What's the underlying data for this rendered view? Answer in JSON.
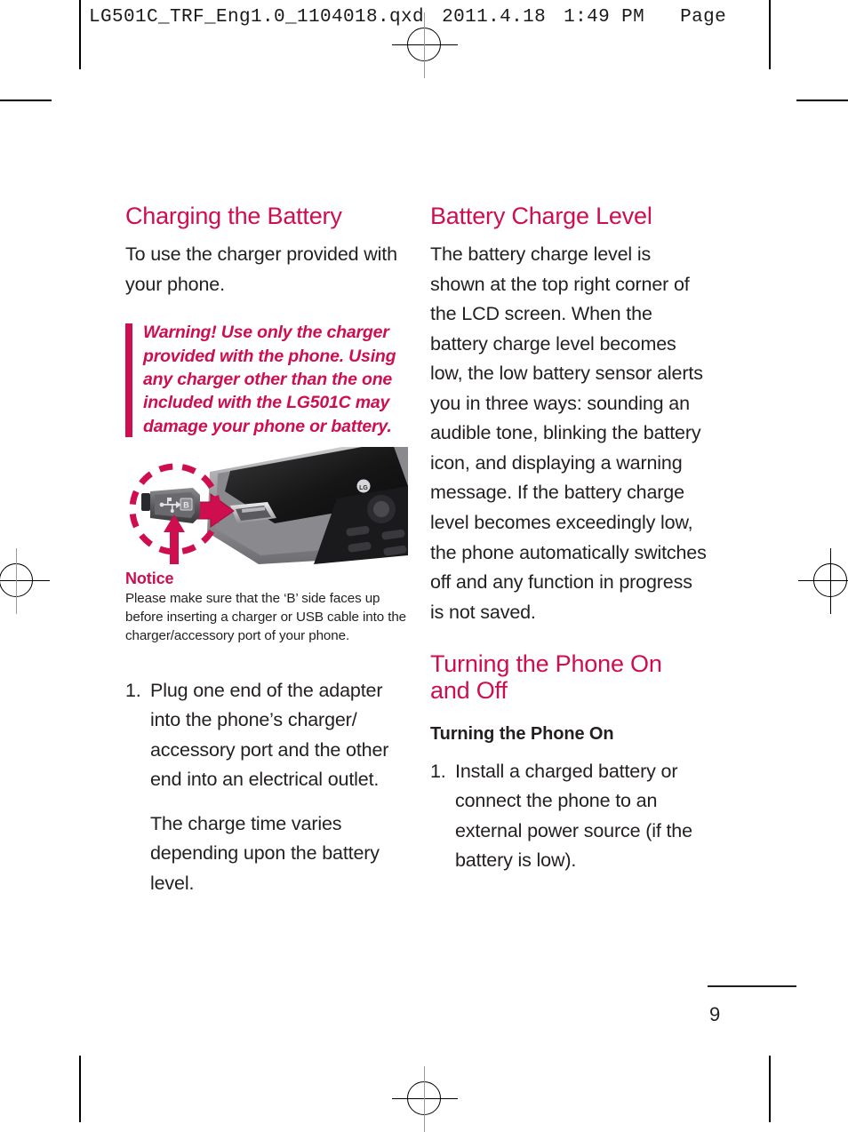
{
  "print_slug": {
    "filename": "LG501C_TRF_Eng1.0_1104018.qxd",
    "date": "2011.4.18",
    "time": "1:49 PM",
    "page_label": "Page"
  },
  "accent_color": "#ce0e4e",
  "text_color": "#231f20",
  "left_column": {
    "heading": "Charging the Battery",
    "intro": "To use the charger provided with your phone.",
    "warning": "Warning! Use only the charger provided with the phone. Using any charger other than the one included with the LG501C may damage your phone or battery.",
    "figure": {
      "caption_alt": "USB charger connector highlighted with dashed circle and arrow pointing into the phone's charger/accessory port",
      "dashed_circle_color": "#ce0e4e",
      "arrow_color": "#ce0e4e"
    },
    "notice_title": "Notice",
    "notice_body": "Please make sure that the ‘B’ side faces up before inserting a charger or USB cable into the charger/accessory port of your phone.",
    "steps": [
      {
        "number": "1.",
        "text": "Plug one end of the adapter into the phone’s charger/ accessory port and the other end into an electrical outlet."
      }
    ],
    "step_followup": "The charge time varies depending upon the battery level."
  },
  "right_column": {
    "heading_battery": "Battery Charge Level",
    "battery_body": "The battery charge level is shown at the top right corner of the LCD screen. When the battery charge level becomes low, the low battery sensor alerts you in three ways: sounding an audible tone, blinking the battery icon, and displaying a warning message. If the battery charge level becomes exceedingly low, the phone automatically switches off and any function in progress is not saved.",
    "heading_turning": "Turning the Phone On and Off",
    "subheading_turning_on": "Turning the Phone On",
    "steps": [
      {
        "number": "1.",
        "text": "Install a charged battery or connect the phone to an external power source (if the battery is low)."
      }
    ]
  },
  "folio": {
    "page_number": "9"
  }
}
